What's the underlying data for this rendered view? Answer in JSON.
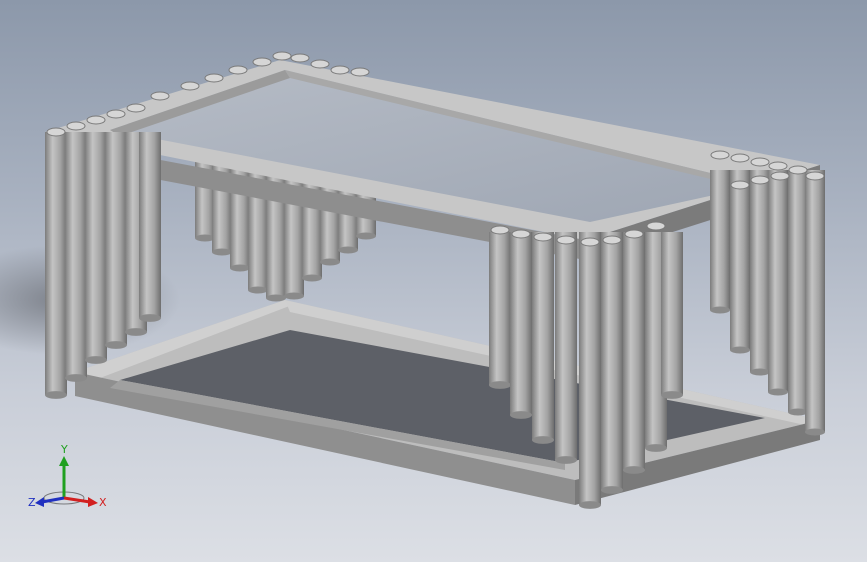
{
  "view": {
    "background_top": "#8c98aa",
    "background_bottom": "#dcdfe5",
    "model_color": "#a6a6a6",
    "glass_color": "#a9b1bd"
  },
  "model": {
    "icon": "coffee-table-model"
  },
  "triad": {
    "x_label": "X",
    "y_label": "Y",
    "z_label": "Z",
    "x_color": "#d22020",
    "y_color": "#20a020",
    "z_color": "#2030c0"
  }
}
